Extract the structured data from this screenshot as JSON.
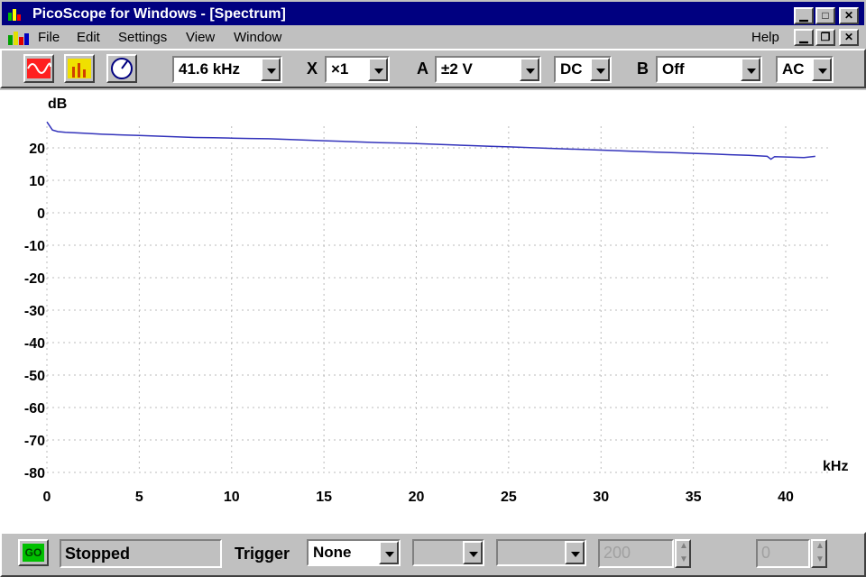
{
  "window": {
    "title": "PicoScope for Windows - [Spectrum]"
  },
  "menu": {
    "items": [
      "File",
      "Edit",
      "Settings",
      "View",
      "Window"
    ],
    "help": "Help"
  },
  "toolbar": {
    "timebase": "41.6 kHz",
    "x_label": "X",
    "x_mult": "×1",
    "a_label": "A",
    "a_range": "±2 V",
    "a_coupling": "DC",
    "b_label": "B",
    "b_range": "Off",
    "b_coupling": "AC"
  },
  "status": {
    "go_label": "GO",
    "state": "Stopped",
    "trigger_label": "Trigger",
    "trigger_mode": "None",
    "samples": "200",
    "delay": "0"
  },
  "colors": {
    "trace": "#3333bb",
    "title_bg": "#000080",
    "face": "#c0c0c0"
  },
  "chart_data": {
    "type": "line",
    "title": "",
    "xlabel": "kHz",
    "ylabel": "dB",
    "xlim": [
      0,
      42
    ],
    "ylim": [
      -80,
      30
    ],
    "xticks": [
      0,
      5,
      10,
      15,
      20,
      25,
      30,
      35,
      40
    ],
    "yticks": [
      20,
      10,
      0,
      -10,
      -20,
      -30,
      -40,
      -50,
      -60,
      -70,
      -80
    ],
    "grid": true,
    "series": [
      {
        "x": [
          0,
          0.3,
          0.6,
          1,
          2,
          3,
          4,
          5,
          6,
          7,
          8,
          9,
          10,
          11,
          12,
          13,
          14,
          15,
          16,
          17,
          18,
          19,
          20,
          21,
          22,
          23,
          24,
          25,
          26,
          27,
          28,
          29,
          30,
          31,
          32,
          33,
          34,
          35,
          36,
          37,
          38,
          39,
          39.2,
          39.4,
          40,
          41,
          41.6
        ],
        "y": [
          28,
          25.5,
          25,
          24.8,
          24.5,
          24.2,
          24,
          23.8,
          23.6,
          23.4,
          23.2,
          23.1,
          23,
          22.9,
          22.8,
          22.6,
          22.4,
          22.2,
          22,
          21.8,
          21.6,
          21.5,
          21.3,
          21.1,
          20.9,
          20.7,
          20.5,
          20.3,
          20.1,
          19.9,
          19.7,
          19.5,
          19.3,
          19.1,
          18.9,
          18.7,
          18.5,
          18.3,
          18.1,
          17.9,
          17.7,
          17.4,
          16.5,
          17.3,
          17.2,
          17,
          17.4
        ]
      }
    ]
  }
}
